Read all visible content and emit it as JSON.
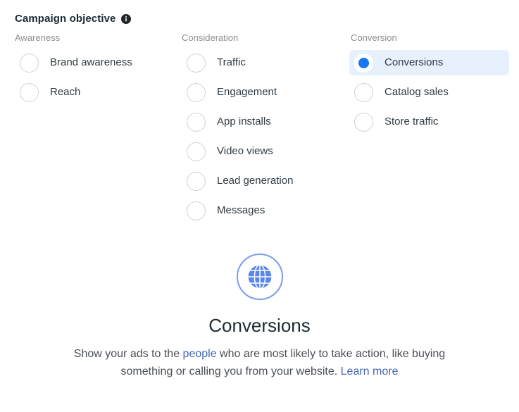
{
  "header": {
    "title": "Campaign objective",
    "info_icon": "info-icon"
  },
  "columns": [
    {
      "header": "Awareness",
      "options": [
        {
          "label": "Brand awareness",
          "selected": false
        },
        {
          "label": "Reach",
          "selected": false
        }
      ]
    },
    {
      "header": "Consideration",
      "options": [
        {
          "label": "Traffic",
          "selected": false
        },
        {
          "label": "Engagement",
          "selected": false
        },
        {
          "label": "App installs",
          "selected": false
        },
        {
          "label": "Video views",
          "selected": false
        },
        {
          "label": "Lead generation",
          "selected": false
        },
        {
          "label": "Messages",
          "selected": false
        }
      ]
    },
    {
      "header": "Conversion",
      "options": [
        {
          "label": "Conversions",
          "selected": true
        },
        {
          "label": "Catalog sales",
          "selected": false
        },
        {
          "label": "Store traffic",
          "selected": false
        }
      ]
    }
  ],
  "detail": {
    "icon": "globe-icon",
    "title": "Conversions",
    "description_part_1": "Show your ads to the ",
    "description_link_1": "people",
    "description_part_2": " who are most likely to take action, like buying something or calling you from your website. ",
    "description_link_2": "Learn more"
  },
  "colors": {
    "accent_blue": "#1877f2",
    "selected_row_background": "#e7f0fd",
    "link_blue": "#3b5998",
    "icon_ring_blue": "#7c9cec",
    "muted_gray": "#8a8d91"
  }
}
